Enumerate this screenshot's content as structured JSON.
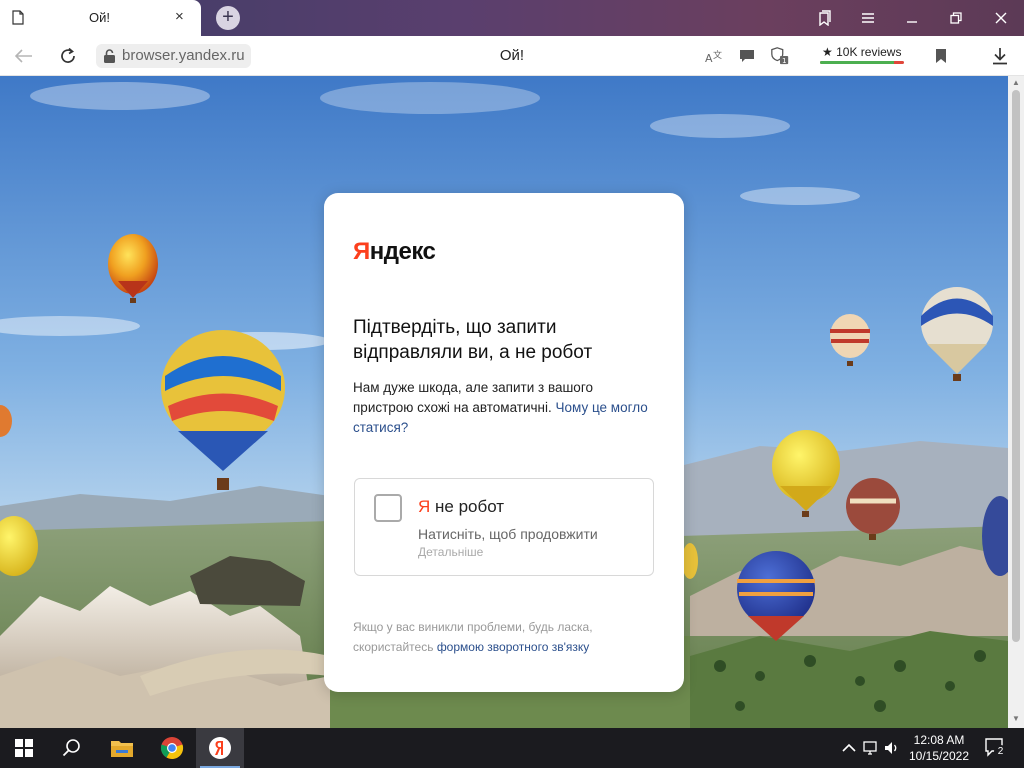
{
  "tab": {
    "title": "Ой!",
    "close": "×"
  },
  "new_tab": "+",
  "window_controls": [
    "collections-icon",
    "menu-icon",
    "minimize-icon",
    "restore-icon",
    "close-icon"
  ],
  "address": {
    "url": "browser.yandex.ru",
    "page_title": "Ой!",
    "reviews_label": "★ 10K reviews",
    "reviews_rating_fraction": 0.88
  },
  "card": {
    "logo_first": "Я",
    "logo_rest": "ндекс",
    "heading": "Підтвердіть, що запити відправляли ви, а не робот",
    "desc_text": "Нам дуже шкода, але запити з вашого пристрою схожі на автоматичні.",
    "desc_link": "Чому це могло статися?",
    "checkbox_ya": "Я",
    "checkbox_label": " не робот",
    "press_text": "Натисніть, щоб продовжити",
    "details_text": "Детальніше",
    "footer_text": "Якщо у вас виникли проблеми, будь ласка, скористайтесь",
    "footer_link": "формою зворотного зв'язку"
  },
  "taskbar": {
    "time": "12:08 AM",
    "date": "10/15/2022",
    "notification_count": "2"
  },
  "colors": {
    "yandex_red": "#fc3f1d",
    "link_blue": "#2b4f8c",
    "taskbar_bg": "#1b1b1f"
  }
}
